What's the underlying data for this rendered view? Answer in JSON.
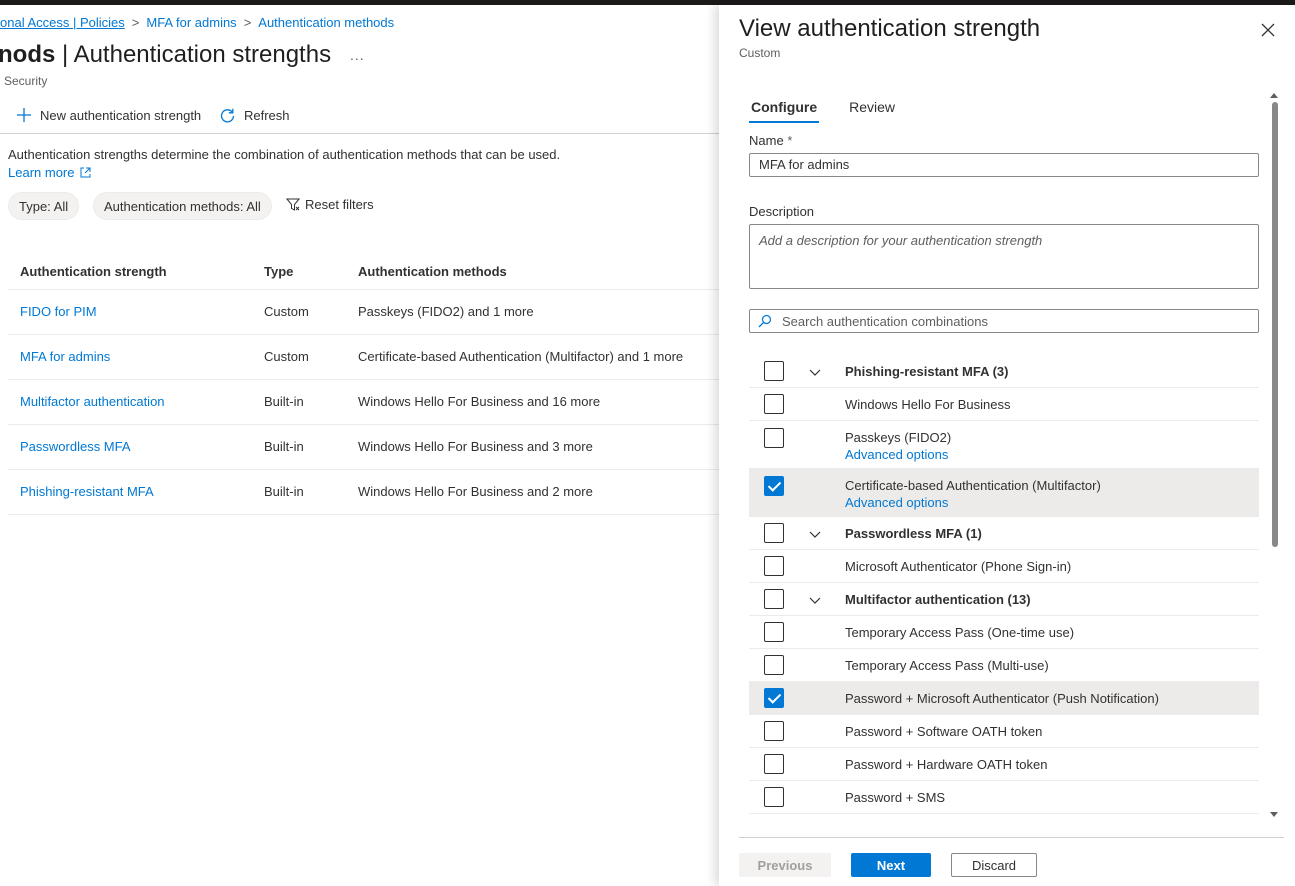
{
  "breadcrumb": [
    "onal Access | Policies",
    "MFA for admins",
    "Authentication methods"
  ],
  "page": {
    "title_bold": "nods",
    "title_rest": " | Authentication strengths",
    "more": "...",
    "subtitle": "Security"
  },
  "toolbar": {
    "new_label": "New authentication strength",
    "refresh_label": "Refresh"
  },
  "description": "Authentication strengths determine the combination of authentication methods that can be used.",
  "learn_more": "Learn more",
  "filters": {
    "type": "Type: All",
    "methods": "Authentication methods: All",
    "reset": "Reset filters"
  },
  "table": {
    "headers": [
      "Authentication strength",
      "Type",
      "Authentication methods"
    ],
    "rows": [
      {
        "name": "FIDO for PIM",
        "type": "Custom",
        "methods": "Passkeys (FIDO2) and 1 more"
      },
      {
        "name": "MFA for admins",
        "type": "Custom",
        "methods": "Certificate-based Authentication (Multifactor) and 1 more"
      },
      {
        "name": "Multifactor authentication",
        "type": "Built-in",
        "methods": "Windows Hello For Business and 16 more"
      },
      {
        "name": "Passwordless MFA",
        "type": "Built-in",
        "methods": "Windows Hello For Business and 3 more"
      },
      {
        "name": "Phishing-resistant MFA",
        "type": "Built-in",
        "methods": "Windows Hello For Business and 2 more"
      }
    ]
  },
  "panel": {
    "title": "View authentication strength",
    "subtitle": "Custom",
    "tabs": [
      "Configure",
      "Review"
    ],
    "name_label": "Name",
    "required_mark": "*",
    "name_value": "MFA for admins",
    "description_label": "Description",
    "description_placeholder": "Add a description for your authentication strength",
    "search_placeholder": "Search authentication combinations",
    "advanced_options": "Advanced options",
    "items": [
      {
        "label": "Phishing-resistant MFA (3)",
        "group": true,
        "checked": false
      },
      {
        "label": "Windows Hello For Business",
        "group": false,
        "checked": false
      },
      {
        "label": "Passkeys (FIDO2)",
        "group": false,
        "checked": false,
        "advanced": true
      },
      {
        "label": "Certificate-based Authentication (Multifactor)",
        "group": false,
        "checked": true,
        "advanced": true
      },
      {
        "label": "Passwordless MFA (1)",
        "group": true,
        "checked": false
      },
      {
        "label": "Microsoft Authenticator (Phone Sign-in)",
        "group": false,
        "checked": false
      },
      {
        "label": "Multifactor authentication (13)",
        "group": true,
        "checked": false
      },
      {
        "label": "Temporary Access Pass (One-time use)",
        "group": false,
        "checked": false
      },
      {
        "label": "Temporary Access Pass (Multi-use)",
        "group": false,
        "checked": false
      },
      {
        "label": "Password + Microsoft Authenticator (Push Notification)",
        "group": false,
        "checked": true
      },
      {
        "label": "Password + Software OATH token",
        "group": false,
        "checked": false
      },
      {
        "label": "Password + Hardware OATH token",
        "group": false,
        "checked": false
      },
      {
        "label": "Password + SMS",
        "group": false,
        "checked": false
      }
    ],
    "buttons": {
      "previous": "Previous",
      "next": "Next",
      "discard": "Discard"
    }
  },
  "colors": {
    "accent": "#0078d4",
    "text": "#323130",
    "selected_row": "#edebe9"
  }
}
